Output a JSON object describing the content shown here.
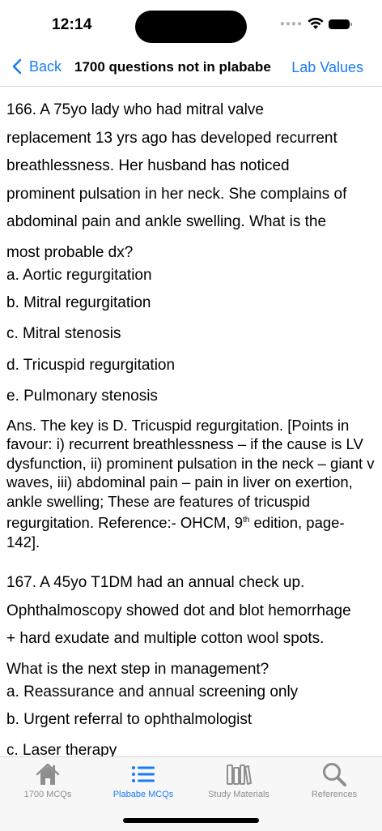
{
  "status_bar": {
    "time": "12:14"
  },
  "nav": {
    "back_label": "Back",
    "title": "1700 questions not in plababe",
    "right_label": "Lab Values"
  },
  "q166": {
    "lines": [
      "166. A 75yo lady who had mitral valve",
      "replacement 13 yrs ago has developed recurrent",
      "breathlessness. Her husband has noticed",
      "prominent pulsation in her neck. She complains of",
      "abdominal pain and ankle swelling. What is the"
    ],
    "tail": "most probable dx?",
    "options": [
      "a. Aortic regurgitation",
      "b. Mitral regurgitation",
      "c. Mitral stenosis",
      "d. Tricuspid regurgitation",
      "e. Pulmonary stenosis"
    ],
    "answer_pre": "Ans. The key is D. Tricuspid regurgitation. [Points in favour: i) recurrent breathlessness – if the cause is LV dysfunction, ii) prominent pulsation in the neck – giant v waves, iii) abdominal pain – pain in liver on exertion, ankle swelling; These are features of tricuspid regurgitation. Reference:- OHCM, 9",
    "answer_sup": "th",
    "answer_post": " edition, page- 142]."
  },
  "q167": {
    "lines": [
      "167. A 45yo T1DM had an annual check up.",
      "Ophthalmoscopy showed dot and blot hemorrhage",
      "+ hard exudate and multiple cotton wool spots."
    ],
    "tail": "What is the next step in management?",
    "options": [
      "a. Reassurance and annual screening only",
      "b. Urgent referral to ophthalmologist",
      "c. Laser therapy"
    ]
  },
  "tabs": [
    {
      "label": "1700 MCQs",
      "icon": "home-icon",
      "active": false
    },
    {
      "label": "Plababe MCQs",
      "icon": "list-icon",
      "active": true
    },
    {
      "label": "Study Materials",
      "icon": "books-icon",
      "active": false
    },
    {
      "label": "References",
      "icon": "magnifier-icon",
      "active": false
    }
  ],
  "colors": {
    "accent": "#1a7cf5",
    "inactive": "#8e8e8e"
  }
}
